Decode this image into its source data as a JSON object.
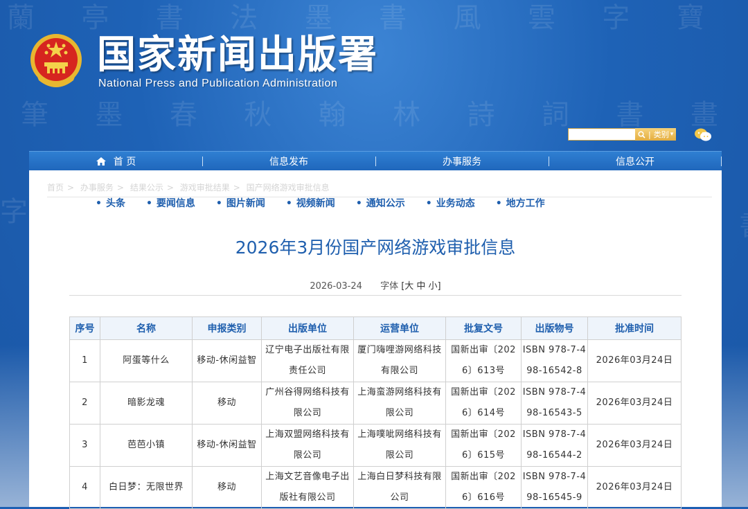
{
  "header": {
    "title": "国家新闻出版署",
    "subtitle": "National Press and Publication Administration",
    "search": {
      "placeholder": "",
      "button_label": "类别",
      "dropdown_glyph": "▾"
    }
  },
  "nav": {
    "items": [
      {
        "label": "首 页",
        "icon": "home-icon"
      },
      {
        "label": "信息发布"
      },
      {
        "label": "办事服务"
      },
      {
        "label": "信息公开"
      }
    ]
  },
  "breadcrumb": [
    "首页",
    "办事服务",
    "结果公示",
    "游戏审批结果",
    "国产网络游戏审批信息"
  ],
  "subnav": [
    "头条",
    "要闻信息",
    "图片新闻",
    "视频新闻",
    "通知公示",
    "业务动态",
    "地方工作"
  ],
  "article": {
    "title": "2026年3月份国产网络游戏审批信息",
    "date": "2026-03-24",
    "font_size_label": "字体",
    "font_size_options": "[大 中 小]"
  },
  "table": {
    "headers": [
      "序号",
      "名称",
      "申报类别",
      "出版单位",
      "运营单位",
      "批复文号",
      "出版物号",
      "批准时间"
    ],
    "rows": [
      [
        "1",
        "阿蛋等什么",
        "移动-休闲益智",
        "辽宁电子出版社有限责任公司",
        "厦门嗨哩游网络科技有限公司",
        "国新出审〔2026〕613号",
        "ISBN 978-7-498-16542-8",
        "2026年03月24日"
      ],
      [
        "2",
        "暗影龙魂",
        "移动",
        "广州谷得网络科技有限公司",
        "上海蛮游网络科技有限公司",
        "国新出审〔2026〕614号",
        "ISBN 978-7-498-16543-5",
        "2026年03月24日"
      ],
      [
        "3",
        "芭芭小镇",
        "移动-休闲益智",
        "上海双盟网络科技有限公司",
        "上海噗呲网络科技有限公司",
        "国新出审〔2026〕615号",
        "ISBN 978-7-498-16544-2",
        "2026年03月24日"
      ],
      [
        "4",
        "白日梦：无限世界",
        "移动",
        "上海文艺音像电子出版社有限公司",
        "上海白日梦科技有限公司",
        "国新出审〔2026〕616号",
        "ISBN 978-7-498-16545-9",
        "2026年03月24日"
      ]
    ]
  },
  "colors": {
    "accent": "#1f5fae",
    "header_bg": "#1d5fb3",
    "search_btn": "#e3ad3f"
  }
}
